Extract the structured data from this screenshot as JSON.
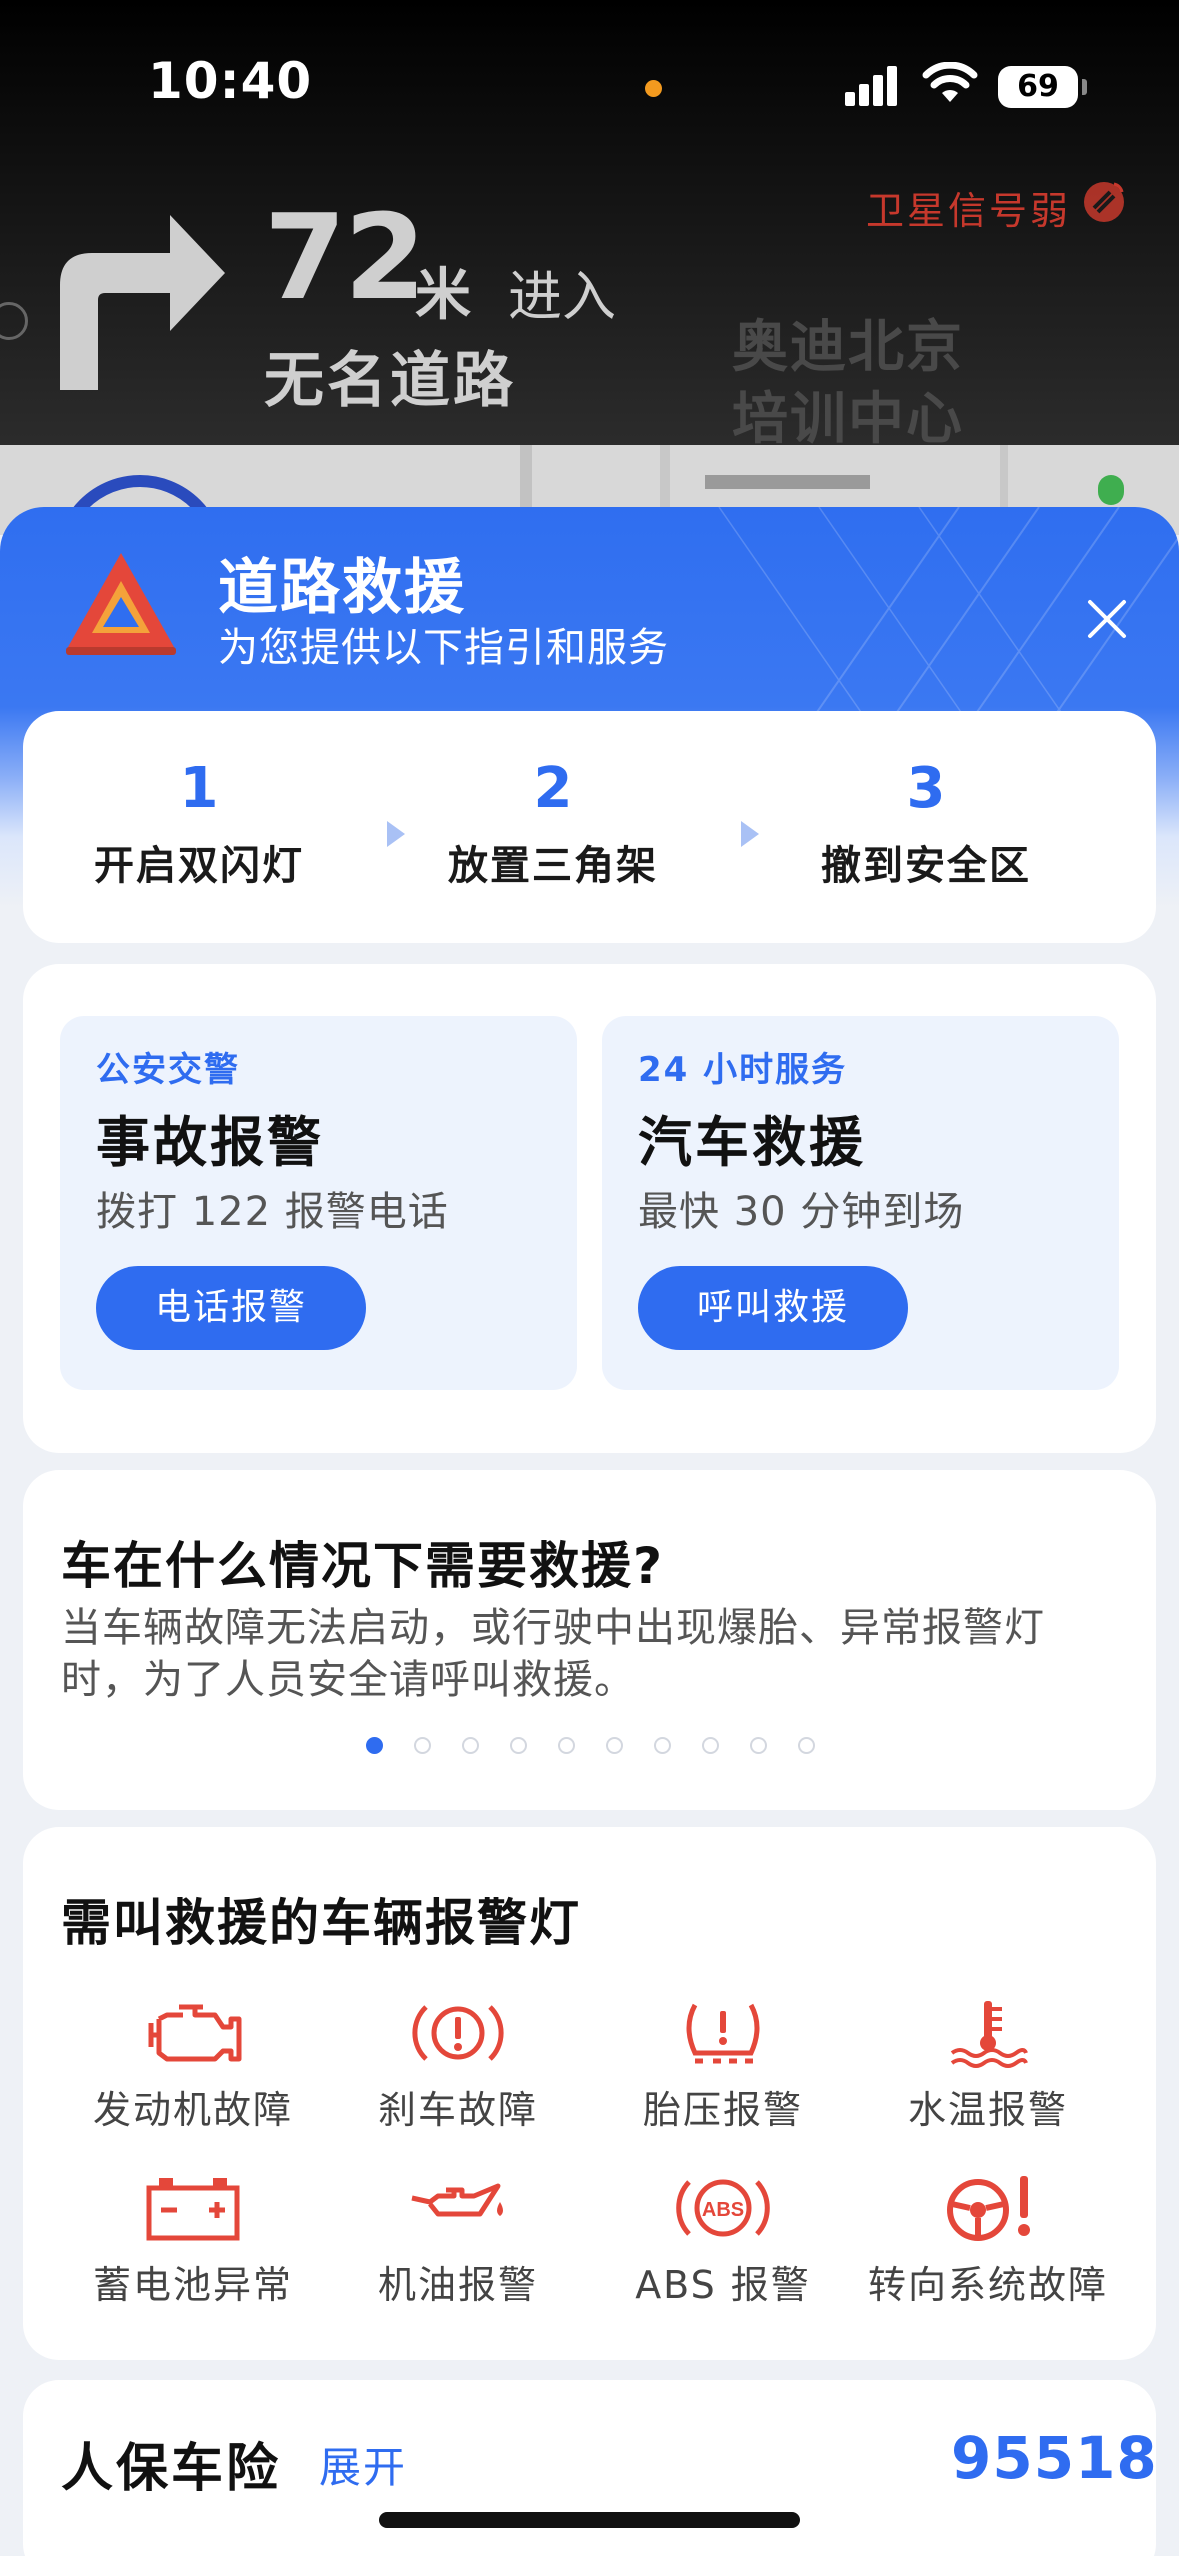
{
  "status_bar": {
    "time": "10:40",
    "battery": "69"
  },
  "navigation": {
    "gps_status": "卫星信号弱",
    "distance_value": "72",
    "distance_unit": "米",
    "action": "进入",
    "road_name": "无名道路",
    "map_poi_label": "奥迪北京培训中心",
    "turn_direction": "right-turn-arrow-icon"
  },
  "rescue_sheet": {
    "title": "道路救援",
    "subtitle": "为您提供以下指引和服务",
    "steps": [
      {
        "num": "1",
        "label": "开启双闪灯"
      },
      {
        "num": "2",
        "label": "放置三角架"
      },
      {
        "num": "3",
        "label": "撤到安全区"
      }
    ],
    "services": [
      {
        "tag": "公安交警",
        "title": "事故报警",
        "desc": "拨打 122 报警电话",
        "button": "电话报警"
      },
      {
        "tag": "24 小时服务",
        "title": "汽车救援",
        "desc": "最快 30 分钟到场",
        "button": "呼叫救援"
      }
    ],
    "info": {
      "title": "车在什么情况下需要救援?",
      "text": "当车辆故障无法启动，或行驶中出现爆胎、异常报警灯时，为了人员安全请呼叫救援。",
      "page_count": 10,
      "active_page": 1
    },
    "warning_lights": {
      "title": "需叫救援的车辆报警灯",
      "items": [
        {
          "label": "发动机故障",
          "icon": "engine-warning-icon"
        },
        {
          "label": "刹车故障",
          "icon": "brake-warning-icon"
        },
        {
          "label": "胎压报警",
          "icon": "tire-pressure-icon"
        },
        {
          "label": "水温报警",
          "icon": "coolant-temperature-icon"
        },
        {
          "label": "蓄电池异常",
          "icon": "battery-warning-icon"
        },
        {
          "label": "机油报警",
          "icon": "oil-pressure-icon"
        },
        {
          "label": "ABS 报警",
          "icon": "abs-warning-icon"
        },
        {
          "label": "转向系统故障",
          "icon": "steering-warning-icon"
        }
      ]
    },
    "insurance": {
      "title": "人保车险",
      "expand": "展开",
      "phone": "95518"
    }
  },
  "colors": {
    "accent": "#2f6cf0",
    "warning_red": "#e4473a",
    "gps_red": "#c6382c"
  }
}
